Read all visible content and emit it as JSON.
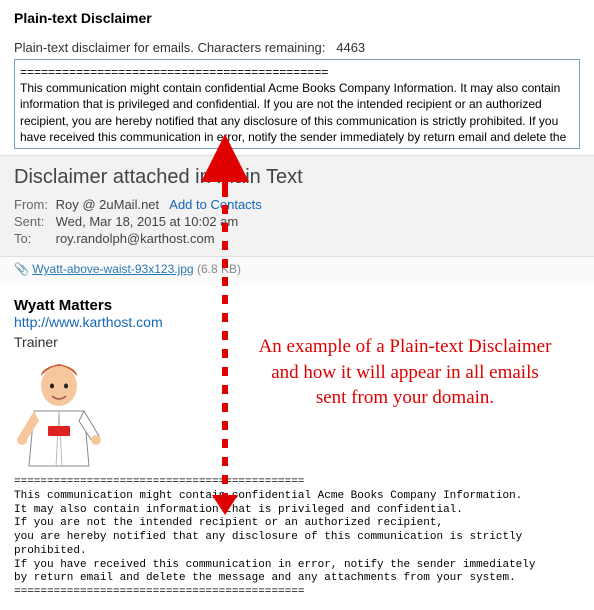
{
  "top": {
    "heading": "Plain-text Disclaimer",
    "remaining_label": "Plain-text disclaimer for emails. Characters remaining:",
    "remaining_value": "4463",
    "textbox_value": "============================================\nThis communication might contain confidential Acme Books Company Information. It may also contain information that is privileged and confidential. If you are not the intended recipient or an authorized recipient, you are hereby notified that any disclosure of this communication is strictly prohibited. If you have received this communication in error, notify the sender immediately by return email and delete the message and any attachments from your system.\n============================================"
  },
  "email": {
    "subject": "Disclaimer attached in Plain Text",
    "from_label": "From:",
    "from_value": "Roy @ 2uMail.net",
    "add_contacts": "Add to Contacts",
    "sent_label": "Sent:",
    "sent_value": "Wed, Mar 18, 2015 at 10:02 am",
    "to_label": "To:",
    "to_value": "roy.randolph@karthost.com"
  },
  "attachment": {
    "name": "Wyatt-above-waist-93x123.jpg",
    "size": "(6.8 KB)"
  },
  "signature": {
    "name": "Wyatt Matters",
    "url": "http://www.karthost.com",
    "title": "Trainer"
  },
  "body_disclaimer": "============================================\nThis communication might contain confidential Acme Books Company Information.\nIt may also contain information that is privileged and confidential.\nIf you are not the intended recipient or an authorized recipient,\nyou are hereby notified that any disclosure of this communication is strictly prohibited.\nIf you have received this communication in error, notify the sender immediately\nby return email and delete the message and any attachments from your system.\n============================================",
  "annotation": {
    "text": "An example of a Plain-text Disclaimer and how it will appear in all emails sent from your domain."
  }
}
